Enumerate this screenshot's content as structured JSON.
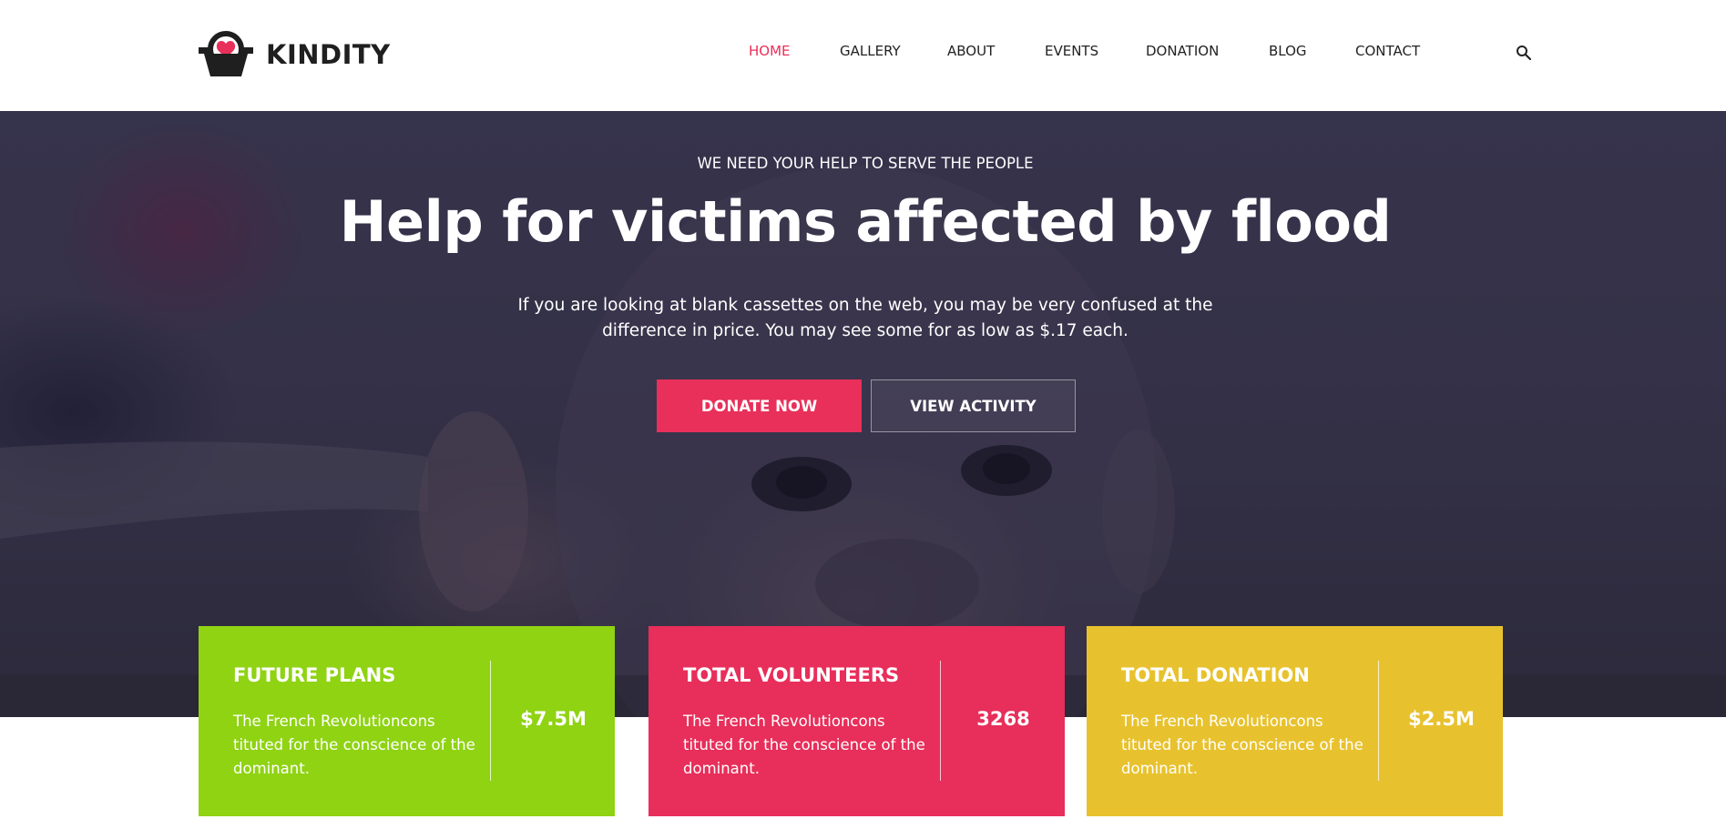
{
  "brand": {
    "name": "KINDITY",
    "accent": "#e8305a"
  },
  "nav": {
    "items": [
      {
        "label": "HOME",
        "active": true
      },
      {
        "label": "GALLERY",
        "active": false
      },
      {
        "label": "ABOUT",
        "active": false
      },
      {
        "label": "EVENTS",
        "active": false
      },
      {
        "label": "DONATION",
        "active": false
      },
      {
        "label": "BLOG",
        "active": false
      },
      {
        "label": "CONTACT",
        "active": false
      }
    ],
    "search_icon": "search-icon"
  },
  "hero": {
    "kicker": "WE NEED YOUR HELP TO SERVE THE PEOPLE",
    "title": "Help for victims affected by flood",
    "text": "If you are looking at blank cassettes on the web, you may be very confused at the difference in price. You may see some for as low as $.17 each.",
    "primary_button": "DONATE NOW",
    "secondary_button": "VIEW ACTIVITY"
  },
  "stats": [
    {
      "title": "FUTURE PLANS",
      "description": "The French Revolutioncons tituted for the conscience of the dominant.",
      "value": "$7.5M",
      "color": "#8fd313"
    },
    {
      "title": "TOTAL VOLUNTEERS",
      "description": "The French Revolutioncons tituted for the conscience of the dominant.",
      "value": "3268",
      "color": "#e82e5a"
    },
    {
      "title": "TOTAL DONATION",
      "description": "The French Revolutioncons tituted for the conscience of the dominant.",
      "value": "$2.5M",
      "color": "#e8c22e"
    }
  ]
}
